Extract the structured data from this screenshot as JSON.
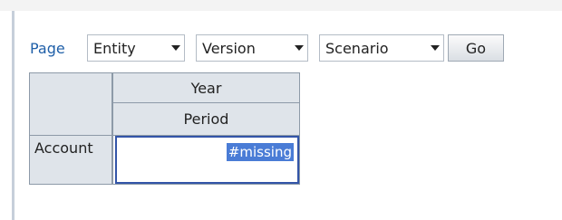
{
  "pov_bar": {
    "page_label": "Page",
    "selectors": [
      {
        "label": "Entity"
      },
      {
        "label": "Version"
      },
      {
        "label": "Scenario"
      }
    ],
    "go_label": "Go"
  },
  "grid": {
    "column_headers": [
      "Year",
      "Period"
    ],
    "row_header": "Account",
    "cell_value": "#missing"
  },
  "icons": {
    "dropdown": "chevron-down-icon"
  },
  "colors": {
    "header_bg": "#dfe4ea",
    "selection": "#4a7cd6",
    "link": "#1f5fa8"
  }
}
